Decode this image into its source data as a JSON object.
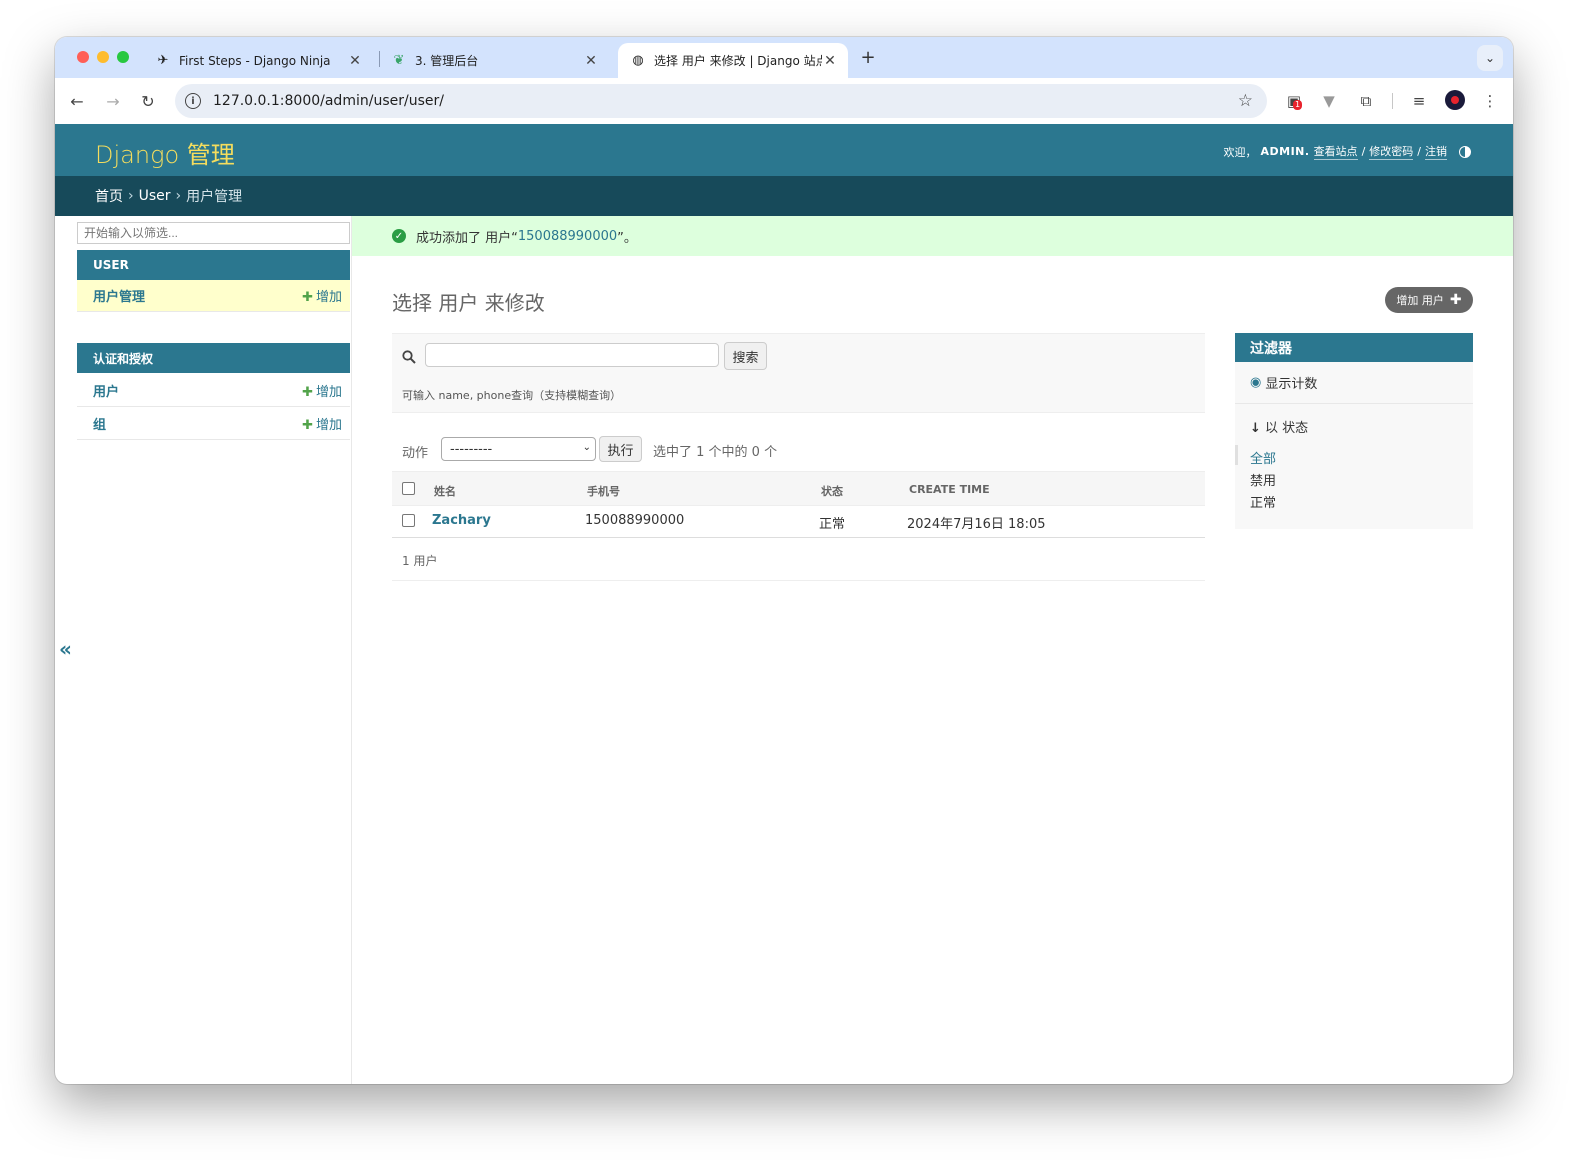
{
  "browser": {
    "tabs": [
      {
        "title": "First Steps - Django Ninja",
        "icon": "django-ninja-icon"
      },
      {
        "title": "3. 管理后台",
        "icon": "leaf-icon"
      },
      {
        "title": "选择 用户 来修改 | Django 站点",
        "icon": "globe-icon",
        "active": true
      }
    ],
    "url": "127.0.0.1:8000/admin/user/user/",
    "extension_badge": "1"
  },
  "header": {
    "brand": "Django 管理",
    "welcome": "欢迎，",
    "username": "ADMIN.",
    "view_site": "查看站点",
    "change_password": "修改密码",
    "logout": "注销",
    "sep": "/"
  },
  "breadcrumbs": {
    "home": "首页",
    "app": "User",
    "current": "用户管理",
    "sep": "›"
  },
  "sidebar": {
    "filter_placeholder": "开始输入以筛选...",
    "collapse": "«",
    "modules": [
      {
        "title": "USER",
        "rows": [
          {
            "name": "用户管理",
            "add": "增加",
            "current": true
          }
        ]
      },
      {
        "title": "认证和授权",
        "rows": [
          {
            "name": "用户",
            "add": "增加"
          },
          {
            "name": "组",
            "add": "增加"
          }
        ]
      }
    ]
  },
  "message": {
    "prefix": "成功添加了 用户“",
    "link": "150088990000",
    "suffix": "”。"
  },
  "content": {
    "title": "选择 用户 来修改",
    "add_button": "增加 用户",
    "search_button": "搜索",
    "search_help": "可输入 name, phone查询（支持模糊查询）",
    "action_label": "动作",
    "action_default": "---------",
    "go_button": "执行",
    "action_counter": "选中了 1 个中的 0 个",
    "columns": [
      "姓名",
      "手机号",
      "状态",
      "CREATE TIME"
    ],
    "rows": [
      {
        "name": "Zachary",
        "phone": "150088990000",
        "status": "正常",
        "create_time": "2024年7月16日 18:05"
      }
    ],
    "paginator": "1 用户"
  },
  "filter": {
    "title": "过滤器",
    "show_counts": "显示计数",
    "by_status": "以 状态",
    "options": [
      "全部",
      "禁用",
      "正常"
    ],
    "selected": "全部"
  },
  "colors": {
    "header": "#2b778f",
    "breadcrumbs": "#174a5a",
    "brand": "#f5dd5d",
    "success_bg": "#ddffdd",
    "link": "#2b778f"
  }
}
